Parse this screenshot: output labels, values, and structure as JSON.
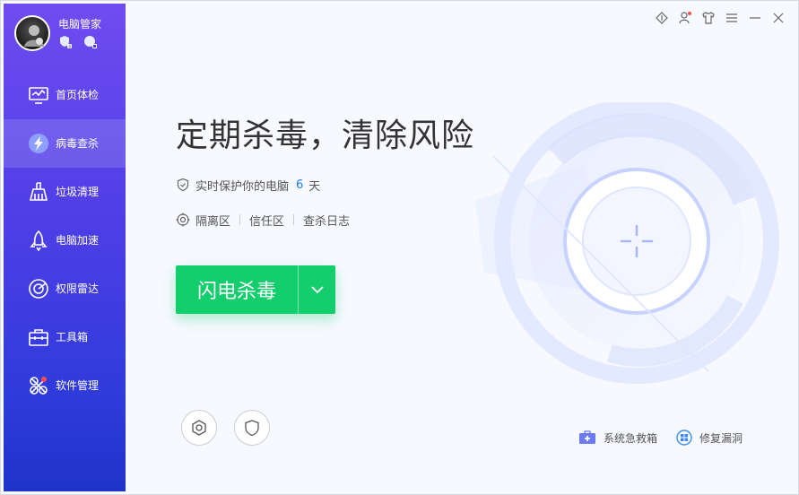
{
  "app": {
    "name": "电脑管家"
  },
  "sidebar": {
    "items": [
      {
        "label": "首页体检",
        "icon": "monitor-icon",
        "active": false
      },
      {
        "label": "病毒查杀",
        "icon": "lightning-icon",
        "active": true
      },
      {
        "label": "垃圾清理",
        "icon": "broom-icon",
        "active": false
      },
      {
        "label": "电脑加速",
        "icon": "rocket-icon",
        "active": false
      },
      {
        "label": "权限雷达",
        "icon": "radar-icon",
        "active": false
      },
      {
        "label": "工具箱",
        "icon": "toolbox-icon",
        "active": false
      },
      {
        "label": "软件管理",
        "icon": "apps-icon",
        "active": false
      }
    ]
  },
  "main": {
    "headline": "定期杀毒，清除风险",
    "protect_text": "实时保护你的电脑",
    "protect_days": "6",
    "protect_unit": "天",
    "links": [
      "隔离区",
      "信任区",
      "查杀日志"
    ],
    "scan_button_label": "闪电杀毒",
    "tools": [
      {
        "label": "系统急救箱",
        "icon": "first-aid-kit-icon"
      },
      {
        "label": "修复漏洞",
        "icon": "windows-repair-icon"
      }
    ]
  },
  "colors": {
    "sidebar_top": "#6f4cf0",
    "sidebar_bottom": "#1f33c9",
    "scan_green": "#14cd6c",
    "days_blue": "#1e7bf0"
  }
}
